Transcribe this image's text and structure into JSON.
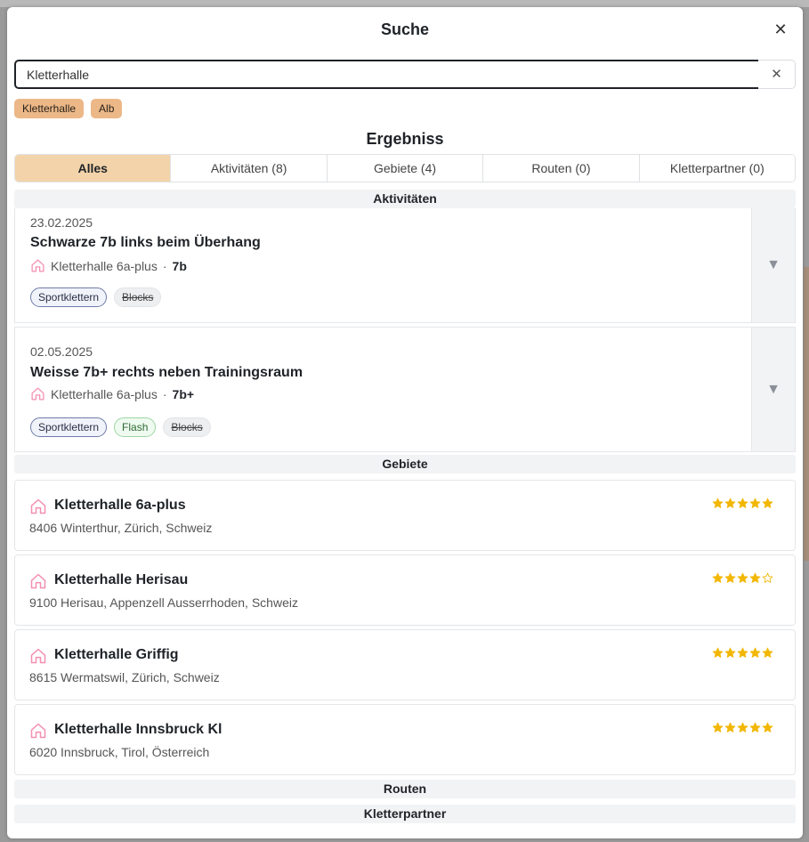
{
  "modal": {
    "title": "Suche",
    "close_label": "✕"
  },
  "search": {
    "value": "Kletterhalle",
    "placeholder": "",
    "clear_label": "✕"
  },
  "chips": [
    "Kletterhalle",
    "Alb"
  ],
  "results": {
    "title": "Ergebniss"
  },
  "tabs": [
    {
      "label": "Alles",
      "active": true
    },
    {
      "label": "Aktivitäten (8)",
      "active": false
    },
    {
      "label": "Gebiete (4)",
      "active": false
    },
    {
      "label": "Routen (0)",
      "active": false
    },
    {
      "label": "Kletterpartner (0)",
      "active": false
    }
  ],
  "sections": {
    "activities": "Aktivitäten",
    "areas": "Gebiete",
    "routes": "Routen",
    "partners": "Kletterpartner"
  },
  "activities": [
    {
      "date": "23.02.2025",
      "name": "Schwarze 7b links beim Überhang",
      "place": "Kletterhalle 6a-plus",
      "grade": "7b",
      "tags": [
        {
          "label": "Sportklettern",
          "style": "sport"
        },
        {
          "label": "Blocks",
          "style": "grey"
        }
      ]
    },
    {
      "date": "02.05.2025",
      "name": "Weisse 7b+ rechts neben Trainingsraum",
      "place": "Kletterhalle 6a-plus",
      "grade": "7b+",
      "tags": [
        {
          "label": "Sportklettern",
          "style": "sport"
        },
        {
          "label": "Flash",
          "style": "flash"
        },
        {
          "label": "Blocks",
          "style": "grey"
        }
      ]
    }
  ],
  "areas": [
    {
      "name": "Kletterhalle 6a-plus",
      "address": "8406 Winterthur, Zürich, Schweiz",
      "rating": 5
    },
    {
      "name": "Kletterhalle Herisau",
      "address": "9100 Herisau, Appenzell Ausserrhoden, Schweiz",
      "rating": 4
    },
    {
      "name": "Kletterhalle Griffig",
      "address": "8615 Wermatswil, Zürich, Schweiz",
      "rating": 5
    },
    {
      "name": "Kletterhalle Innsbruck Kl",
      "address": "6020 Innsbruck, Tirol, Österreich",
      "rating": 5
    }
  ],
  "icons": {
    "home": "home-icon",
    "star": "star-icon",
    "expand": "chevron-down-icon",
    "close": "close-icon"
  },
  "colors": {
    "chip": "#ecb888",
    "active_tab": "#f3d4aa",
    "star": "#f2b705",
    "home_icon": "#f48fb1"
  }
}
